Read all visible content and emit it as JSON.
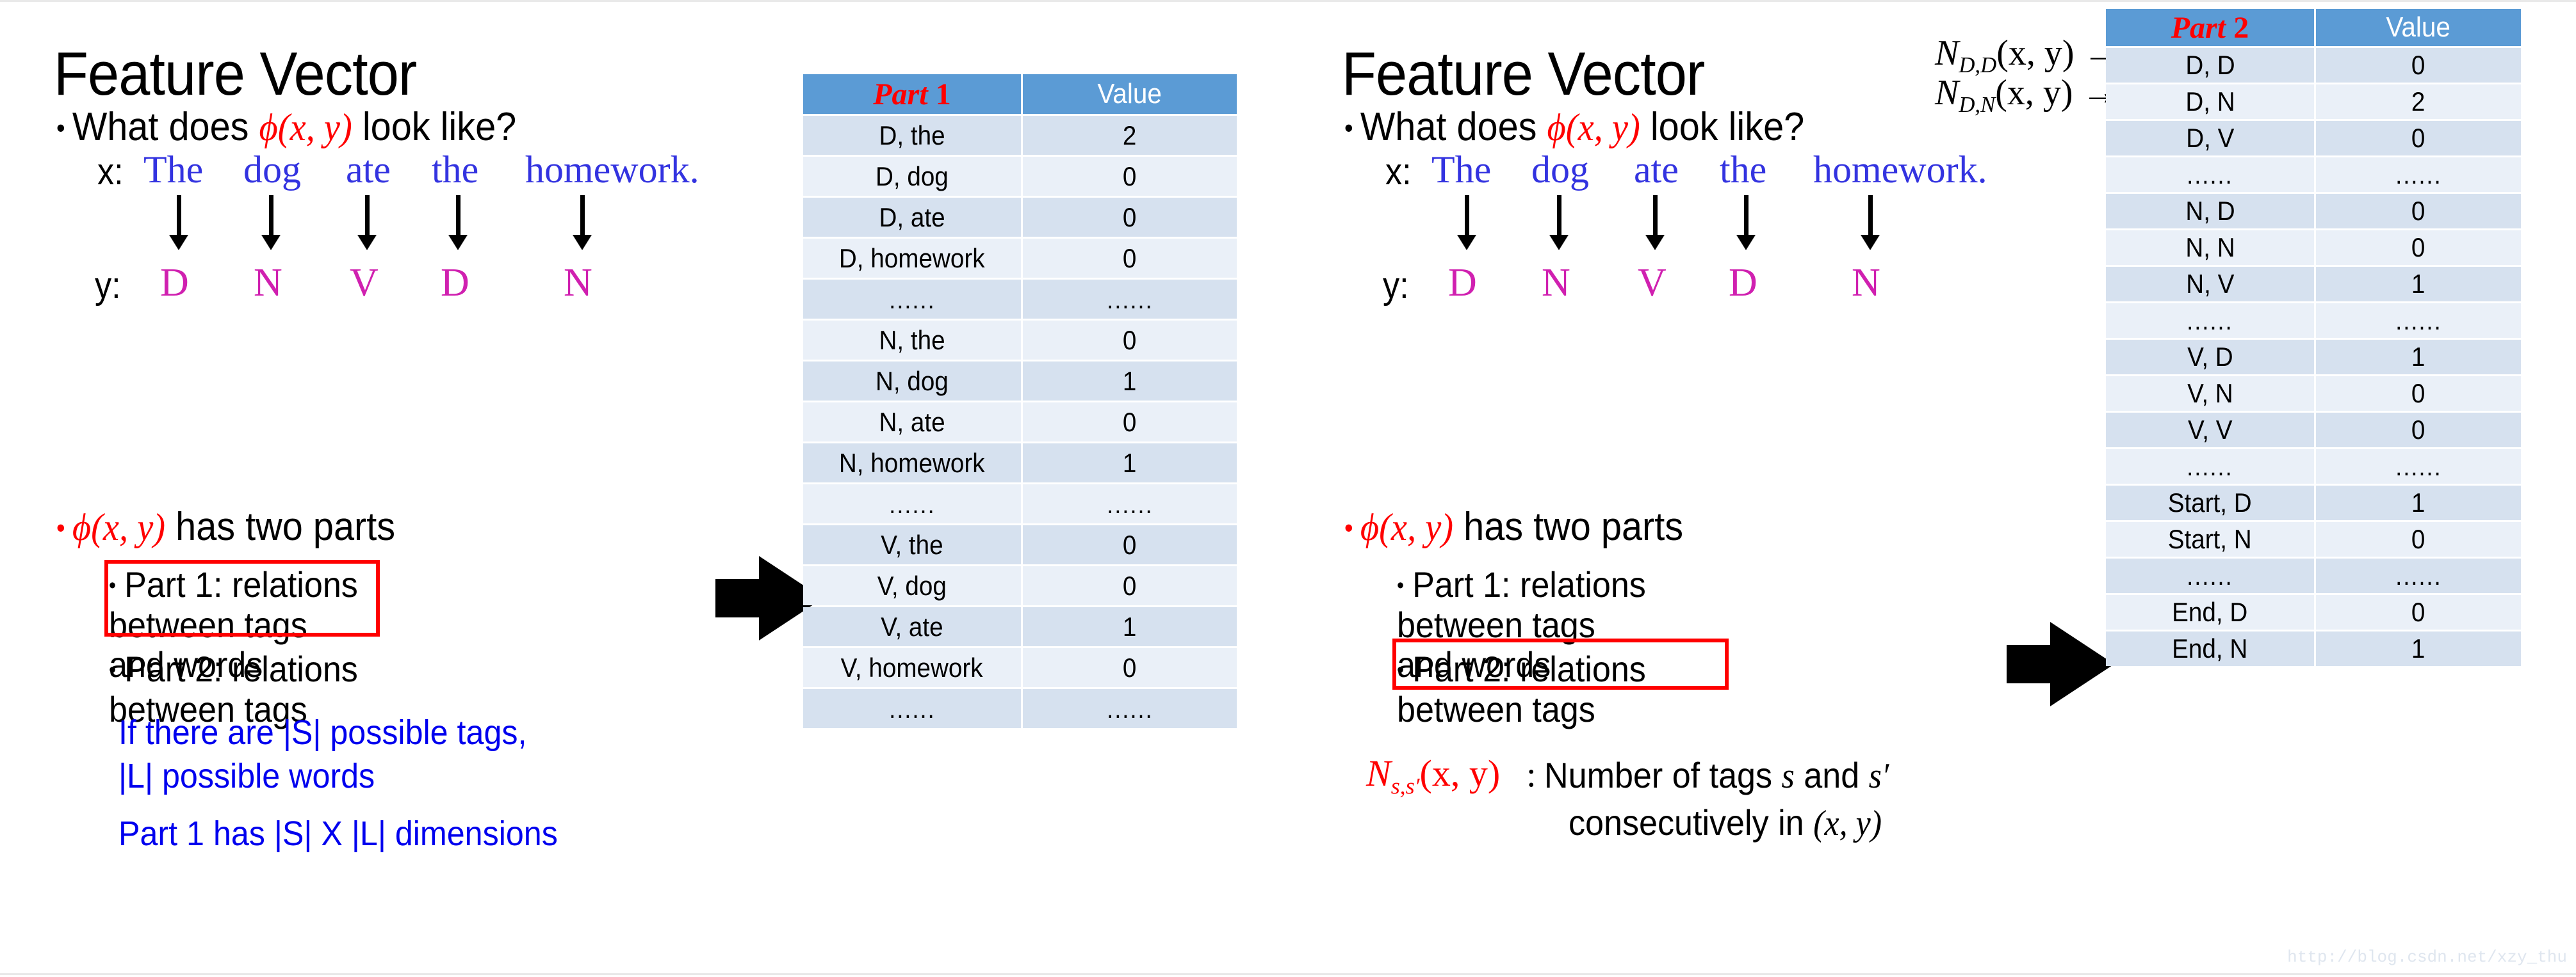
{
  "slide": {
    "watermark": "http://blog.csdn.net/xzy_thu"
  },
  "left": {
    "title": "Feature Vector",
    "question_prefix": "What does",
    "phi": "ϕ(x, y)",
    "question_suffix": "look like?",
    "x_label": "x:",
    "y_label": "y:",
    "words": [
      "The",
      "dog",
      "ate",
      "the",
      "homework."
    ],
    "tags": [
      "D",
      "N",
      "V",
      "D",
      "N"
    ],
    "two_parts_suffix": "has two parts",
    "part1_bullet": "Part 1: relations between tags and words",
    "part2_bullet": "Part 2: relations between tags",
    "note_line1": "If there are |S| possible tags,",
    "note_line2": "|L| possible words",
    "note_line3": "Part 1 has |S| X |L| dimensions",
    "arrow_icon": "right-block-arrow"
  },
  "right": {
    "title": "Feature Vector",
    "question_prefix": "What does",
    "phi": "ϕ(x, y)",
    "question_suffix": "look like?",
    "x_label": "x:",
    "y_label": "y:",
    "words": [
      "The",
      "dog",
      "ate",
      "the",
      "homework."
    ],
    "tags": [
      "D",
      "N",
      "V",
      "D",
      "N"
    ],
    "two_parts_suffix": "has two parts",
    "part1_bullet": "Part 1: relations between tags and words",
    "part2_bullet": "Part 2: relations between tags",
    "n_def_name": "N",
    "n_def_sub": "s,s′",
    "n_def_args": "(x, y)",
    "n_def_colon": ":",
    "n_def_text_line1_a": "Number of tags",
    "n_def_text_line1_s": "s",
    "n_def_text_line1_b": "and",
    "n_def_text_line1_sp": "s′",
    "n_def_text_line2_a": "consecutively in",
    "n_def_text_line2_xy": "(x, y)",
    "annotations": [
      {
        "name": "N",
        "sub": "D,D",
        "args": "(x, y)",
        "arrow": "→"
      },
      {
        "name": "N",
        "sub": "D,N",
        "args": "(x, y)",
        "arrow": "→"
      }
    ],
    "arrow_icon": "right-block-arrow"
  },
  "chart_data": [
    {
      "type": "table",
      "title": "Part 1",
      "columns": [
        "Part 1",
        "Value"
      ],
      "rows": [
        [
          "D, the",
          "2"
        ],
        [
          "D, dog",
          "0"
        ],
        [
          "D, ate",
          "0"
        ],
        [
          "D, homework",
          "0"
        ],
        [
          "......",
          "......"
        ],
        [
          "N, the",
          "0"
        ],
        [
          "N, dog",
          "1"
        ],
        [
          "N, ate",
          "0"
        ],
        [
          "N, homework",
          "1"
        ],
        [
          "......",
          "......"
        ],
        [
          "V, the",
          "0"
        ],
        [
          "V, dog",
          "0"
        ],
        [
          "V, ate",
          "1"
        ],
        [
          "V, homework",
          "0"
        ],
        [
          "......",
          "......"
        ]
      ]
    },
    {
      "type": "table",
      "title": "Part 2",
      "columns": [
        "Part 2",
        "Value"
      ],
      "rows": [
        [
          "D, D",
          "0"
        ],
        [
          "D, N",
          "2"
        ],
        [
          "D, V",
          "0"
        ],
        [
          "......",
          "......"
        ],
        [
          "N, D",
          "0"
        ],
        [
          "N, N",
          "0"
        ],
        [
          "N, V",
          "1"
        ],
        [
          "......",
          "......"
        ],
        [
          "V, D",
          "1"
        ],
        [
          "V, N",
          "0"
        ],
        [
          "V, V",
          "0"
        ],
        [
          "......",
          "......"
        ],
        [
          "Start, D",
          "1"
        ],
        [
          "Start, N",
          "0"
        ],
        [
          "......",
          "......"
        ],
        [
          "End, D",
          "0"
        ],
        [
          "End, N",
          "1"
        ]
      ]
    }
  ]
}
